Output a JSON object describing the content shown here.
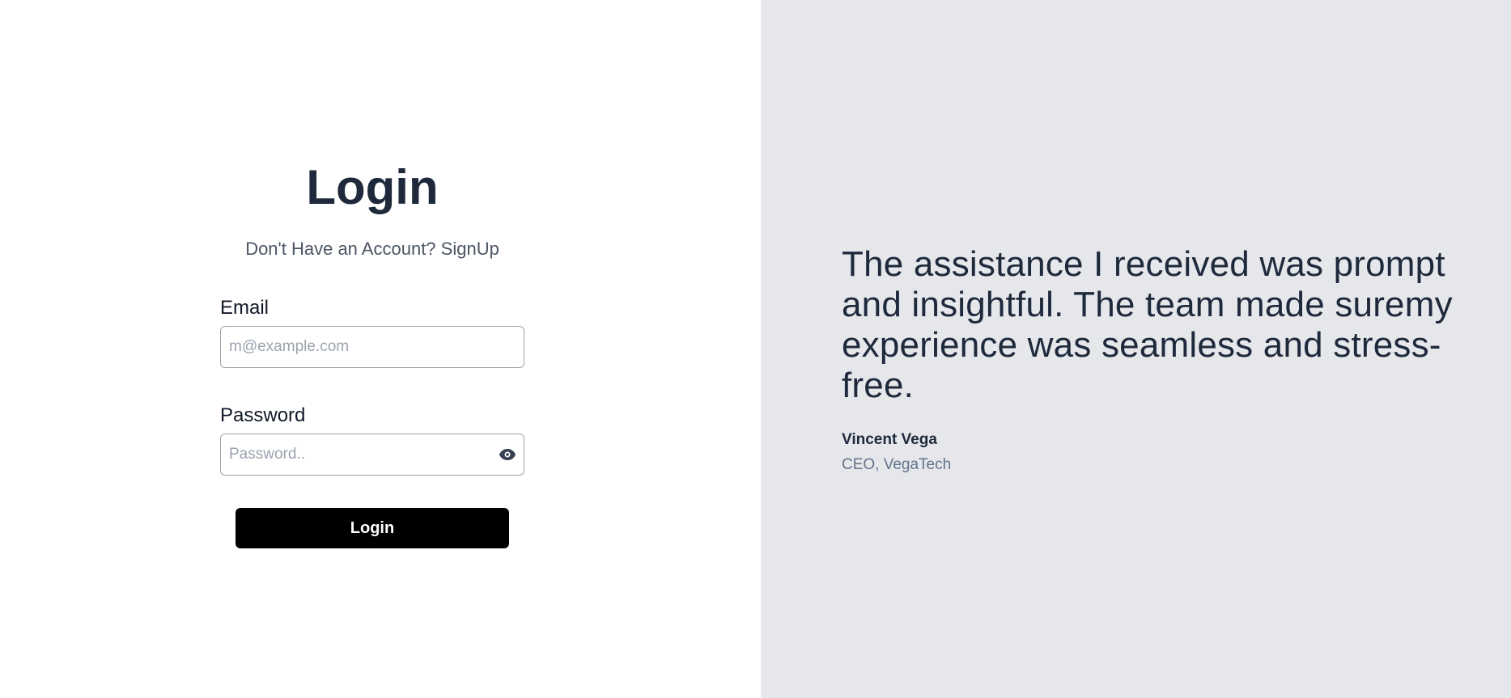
{
  "login": {
    "title": "Login",
    "signup_prompt": "Don't Have an Account? ",
    "signup_link": "SignUp",
    "email_label": "Email",
    "email_placeholder": "m@example.com",
    "email_value": "",
    "password_label": "Password",
    "password_placeholder": "Password..",
    "password_value": "",
    "password_toggle_icon": "eye-icon",
    "submit_label": "Login"
  },
  "testimonial": {
    "quote": "The assistance I received was prompt and insightful. The team made suremy experience was seamless and stress-free.",
    "author_name": "Vincent Vega",
    "author_role": "CEO, VegaTech"
  },
  "colors": {
    "left_background": "#ffffff",
    "right_background": "#e5e7eb",
    "primary_button": "#000000",
    "heading_text": "#1e293b",
    "muted_text": "#64748b"
  }
}
